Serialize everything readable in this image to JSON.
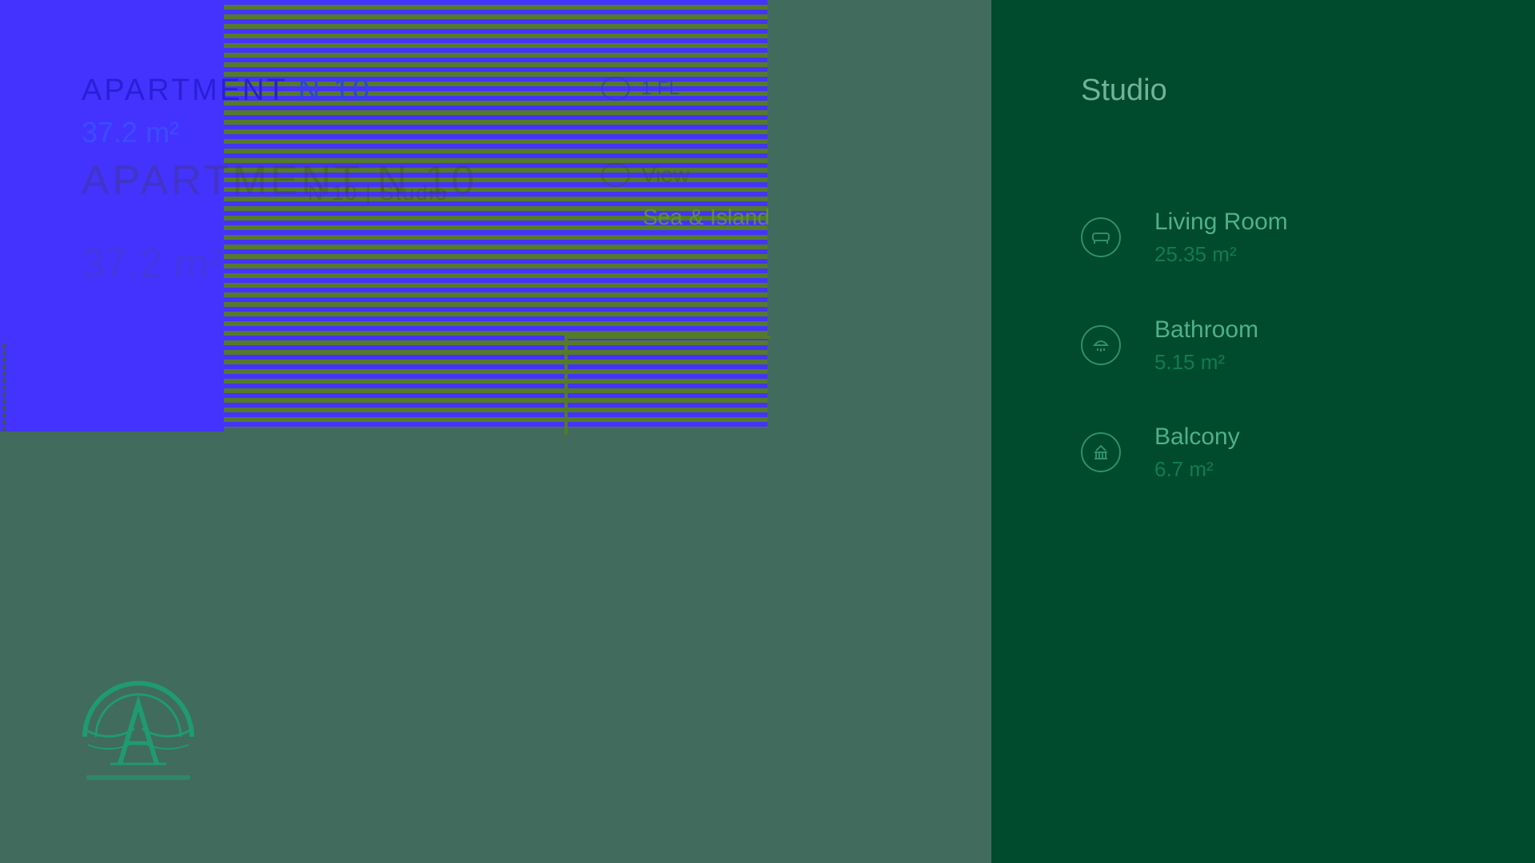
{
  "apartment": {
    "title_word": "APARTMENT",
    "title_number": "N 10",
    "area": "37.2 m²",
    "ghost_title": "APARTMENT N 10",
    "ghost_subtitle": "N 10 | Studio",
    "ghost_area": "37.2 m²"
  },
  "info": {
    "floor_label": "1 FL",
    "view_label": "View",
    "view_value": "Sea & Island"
  },
  "panel": {
    "title": "Studio",
    "rooms": [
      {
        "name": "Living Room",
        "area": "25.35 m²",
        "icon": "sofa-icon"
      },
      {
        "name": "Bathroom",
        "area": "5.15 m²",
        "icon": "shower-icon"
      },
      {
        "name": "Balcony",
        "area": "6.7 m²",
        "icon": "balcony-icon"
      }
    ]
  },
  "colors": {
    "background": "#416b5c",
    "panel": "#004a2e",
    "accent": "#4fb08a",
    "blue": "#4433ff",
    "stripe_green": "#557a2a"
  }
}
